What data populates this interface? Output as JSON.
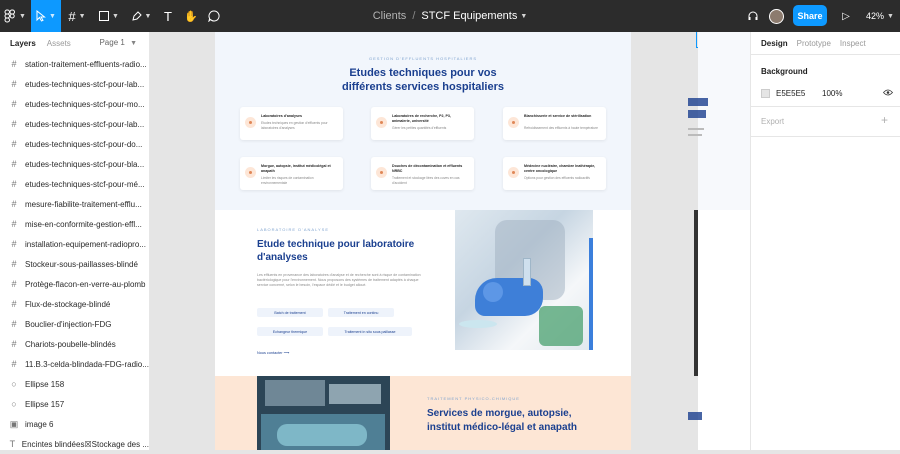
{
  "toolbar": {
    "breadcrumb": "Clients",
    "separator": "/",
    "file_name": "STCF Equipements",
    "share_label": "Share",
    "zoom": "42%"
  },
  "left_panel": {
    "tabs": [
      "Layers",
      "Assets"
    ],
    "page": "Page 1",
    "layers": [
      {
        "icon": "#",
        "label": "station-traitement-effluents-radio..."
      },
      {
        "icon": "#",
        "label": "etudes-techniques-stcf-pour-lab..."
      },
      {
        "icon": "#",
        "label": "etudes-techniques-stcf-pour-mo..."
      },
      {
        "icon": "#",
        "label": "etudes-techniques-stcf-pour-lab..."
      },
      {
        "icon": "#",
        "label": "etudes-techniques-stcf-pour-do..."
      },
      {
        "icon": "#",
        "label": "etudes-techniques-stcf-pour-bla..."
      },
      {
        "icon": "#",
        "label": "etudes-techniques-stcf-pour-mé..."
      },
      {
        "icon": "#",
        "label": "mesure-fiabilite-traitement-efflu..."
      },
      {
        "icon": "#",
        "label": "mise-en-conformite-gestion-effl..."
      },
      {
        "icon": "#",
        "label": "installation-equipement-radiopro..."
      },
      {
        "icon": "#",
        "label": "Stockeur-sous-paillasses-blindé"
      },
      {
        "icon": "#",
        "label": "Protège-flacon-en-verre-au-plomb"
      },
      {
        "icon": "#",
        "label": "Flux-de-stockage-blindé"
      },
      {
        "icon": "#",
        "label": "Bouclier-d'injection-FDG"
      },
      {
        "icon": "#",
        "label": "Chariots-poubelle-blindés"
      },
      {
        "icon": "#",
        "label": "11.B.3-celda-blindada-FDG-radio..."
      },
      {
        "icon": "○",
        "label": "Ellipse 158"
      },
      {
        "icon": "○",
        "label": "Ellipse 157"
      },
      {
        "icon": "▣",
        "label": "image 6"
      },
      {
        "icon": "T",
        "label": "Encintes blindées☒Stockage des ..."
      }
    ]
  },
  "canvas": {
    "hero_kicker": "GESTION D'EFFLUENTS HOSPITALIERS",
    "hero_title_1": "Etudes techniques pour vos",
    "hero_title_2": "différents services hospitaliers",
    "cards": [
      {
        "title": "Laboratoires d'analyses",
        "desc": "Etudes techniques en gestion d'effluents pour laboratoires d'analyses"
      },
      {
        "title": "Laboratoires de recherche, P2, P3, animalerie, université",
        "desc": "Gérer les petites quantités d'effluents"
      },
      {
        "title": "Blanchisserie et service de stérilisation",
        "desc": "Refroidissement des effluents à haute température"
      },
      {
        "title": "Morgue, autopsie, institut médicolégal et anapath",
        "desc": "Limiter les risques de contamination environnementale"
      },
      {
        "title": "Douches de décontamination et effluents NRBC",
        "desc": "Traitement et stockage liées des cuves en cas d'accident"
      },
      {
        "title": "Médecine nucléaire, chambre lnathérapie, centre oncologique",
        "desc": "Options pour gestion des effluents radioactifs"
      }
    ],
    "lab_kicker": "LABORATOIRE D'ANALYSE",
    "lab_title": "Etude technique pour laboratoire d'analyses",
    "lab_text": "Les effluents en provenance des laboratoires d'analyse et de recherche sont à risque de contamination bactériologique pour l'environnement. Nous proposons des systèmes de traitement adaptés à chaque service concerné, selon le besoin, l'espace dédié et le budget alloué.",
    "pills": [
      "Batch de traitement",
      "Traitement en continu",
      "Echangeur thermique",
      "Traitement in situ sous paillasse"
    ],
    "more_link": "Nous contacter",
    "morgue_kicker": "TRAITEMENT PHYSICO-CHIMIQUE",
    "morgue_title": "Services de morgue, autopsie, institut médico-légal et anapath"
  },
  "right_panel": {
    "tabs": [
      "Design",
      "Prototype",
      "Inspect"
    ],
    "background_title": "Background",
    "background_color_hex": "E5E5E5",
    "background_opacity": "100%",
    "export_title": "Export"
  },
  "colors": {
    "accent": "#0d99ff",
    "toolbar": "#2c2c2c",
    "canvas_bg": "#e5e5e5",
    "heading_blue": "#1a3f8f",
    "peach": "#fde6d5"
  }
}
